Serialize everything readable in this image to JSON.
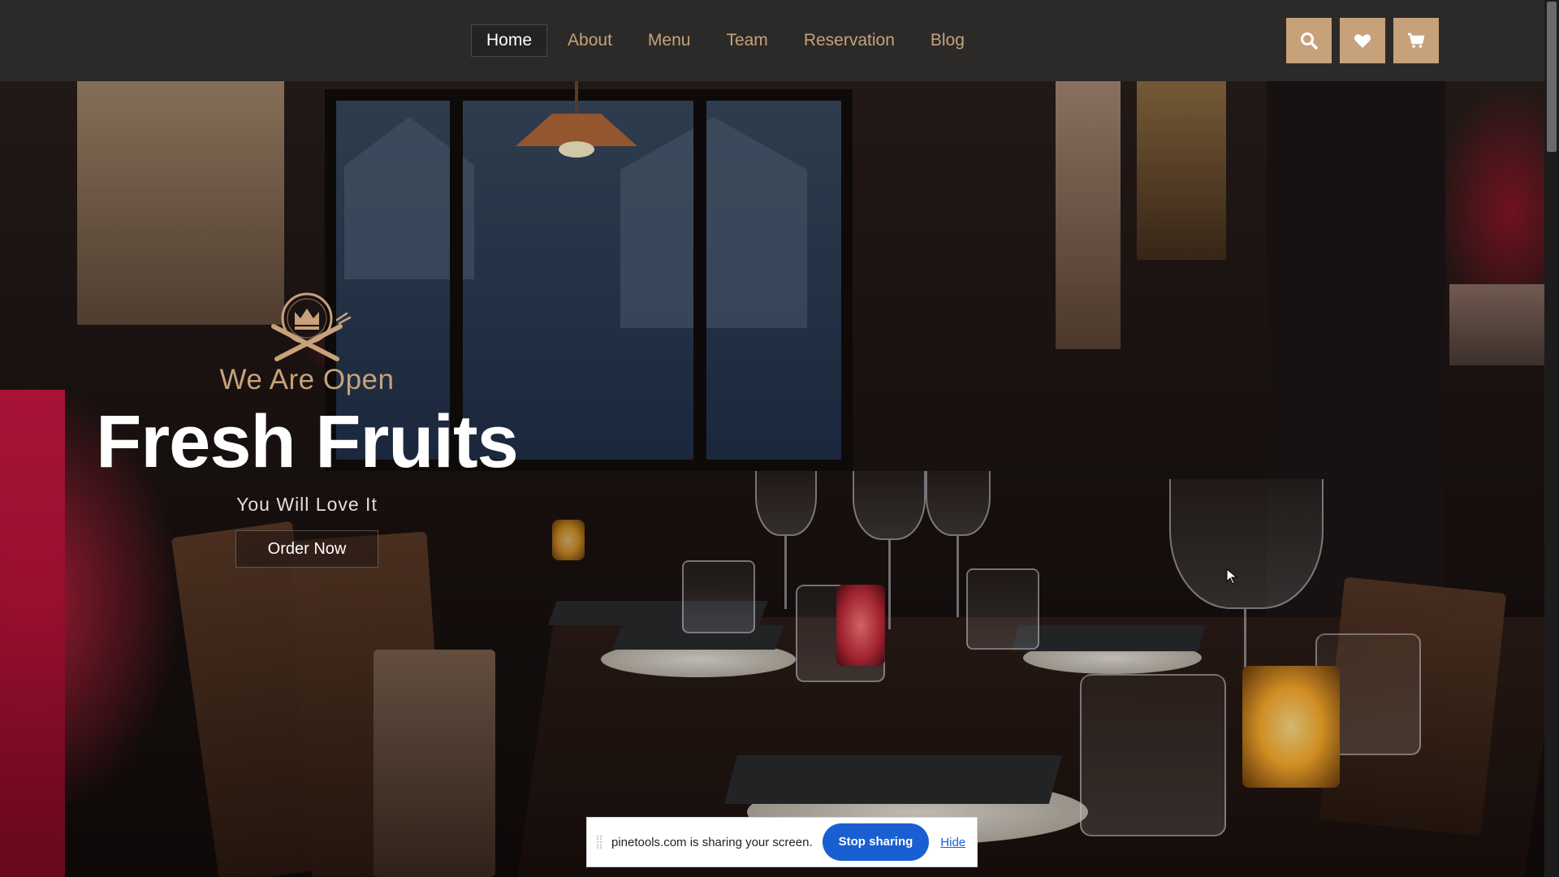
{
  "nav": {
    "items": [
      {
        "label": "Home",
        "active": true
      },
      {
        "label": "About",
        "active": false
      },
      {
        "label": "Menu",
        "active": false
      },
      {
        "label": "Team",
        "active": false
      },
      {
        "label": "Reservation",
        "active": false
      },
      {
        "label": "Blog",
        "active": false
      }
    ],
    "actions": [
      {
        "icon": "search-icon"
      },
      {
        "icon": "heart-icon"
      },
      {
        "icon": "cart-icon"
      }
    ]
  },
  "hero": {
    "logo_icon": "crown-fork-knife-icon",
    "eyebrow": "We Are Open",
    "title": "Fresh Fruits",
    "subtitle": "You Will Love It",
    "cta_label": "Order Now"
  },
  "share_bar": {
    "message": "pinetools.com is sharing your screen.",
    "stop_label": "Stop sharing",
    "hide_label": "Hide"
  },
  "colors": {
    "nav_bg": "#2b2a29",
    "accent": "#c7a17a",
    "share_button": "#1a5fd1"
  }
}
